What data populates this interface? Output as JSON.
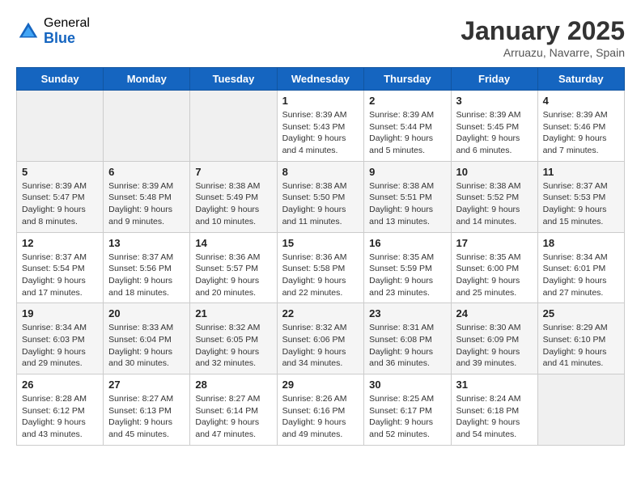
{
  "logo": {
    "general": "General",
    "blue": "Blue"
  },
  "title": "January 2025",
  "subtitle": "Arruazu, Navarre, Spain",
  "weekdays": [
    "Sunday",
    "Monday",
    "Tuesday",
    "Wednesday",
    "Thursday",
    "Friday",
    "Saturday"
  ],
  "weeks": [
    [
      {
        "day": "",
        "empty": true
      },
      {
        "day": "",
        "empty": true
      },
      {
        "day": "",
        "empty": true
      },
      {
        "day": "1",
        "sunrise": "8:39 AM",
        "sunset": "5:43 PM",
        "daylight": "9 hours and 4 minutes."
      },
      {
        "day": "2",
        "sunrise": "8:39 AM",
        "sunset": "5:44 PM",
        "daylight": "9 hours and 5 minutes."
      },
      {
        "day": "3",
        "sunrise": "8:39 AM",
        "sunset": "5:45 PM",
        "daylight": "9 hours and 6 minutes."
      },
      {
        "day": "4",
        "sunrise": "8:39 AM",
        "sunset": "5:46 PM",
        "daylight": "9 hours and 7 minutes."
      }
    ],
    [
      {
        "day": "5",
        "sunrise": "8:39 AM",
        "sunset": "5:47 PM",
        "daylight": "9 hours and 8 minutes."
      },
      {
        "day": "6",
        "sunrise": "8:39 AM",
        "sunset": "5:48 PM",
        "daylight": "9 hours and 9 minutes."
      },
      {
        "day": "7",
        "sunrise": "8:38 AM",
        "sunset": "5:49 PM",
        "daylight": "9 hours and 10 minutes."
      },
      {
        "day": "8",
        "sunrise": "8:38 AM",
        "sunset": "5:50 PM",
        "daylight": "9 hours and 11 minutes."
      },
      {
        "day": "9",
        "sunrise": "8:38 AM",
        "sunset": "5:51 PM",
        "daylight": "9 hours and 13 minutes."
      },
      {
        "day": "10",
        "sunrise": "8:38 AM",
        "sunset": "5:52 PM",
        "daylight": "9 hours and 14 minutes."
      },
      {
        "day": "11",
        "sunrise": "8:37 AM",
        "sunset": "5:53 PM",
        "daylight": "9 hours and 15 minutes."
      }
    ],
    [
      {
        "day": "12",
        "sunrise": "8:37 AM",
        "sunset": "5:54 PM",
        "daylight": "9 hours and 17 minutes."
      },
      {
        "day": "13",
        "sunrise": "8:37 AM",
        "sunset": "5:56 PM",
        "daylight": "9 hours and 18 minutes."
      },
      {
        "day": "14",
        "sunrise": "8:36 AM",
        "sunset": "5:57 PM",
        "daylight": "9 hours and 20 minutes."
      },
      {
        "day": "15",
        "sunrise": "8:36 AM",
        "sunset": "5:58 PM",
        "daylight": "9 hours and 22 minutes."
      },
      {
        "day": "16",
        "sunrise": "8:35 AM",
        "sunset": "5:59 PM",
        "daylight": "9 hours and 23 minutes."
      },
      {
        "day": "17",
        "sunrise": "8:35 AM",
        "sunset": "6:00 PM",
        "daylight": "9 hours and 25 minutes."
      },
      {
        "day": "18",
        "sunrise": "8:34 AM",
        "sunset": "6:01 PM",
        "daylight": "9 hours and 27 minutes."
      }
    ],
    [
      {
        "day": "19",
        "sunrise": "8:34 AM",
        "sunset": "6:03 PM",
        "daylight": "9 hours and 29 minutes."
      },
      {
        "day": "20",
        "sunrise": "8:33 AM",
        "sunset": "6:04 PM",
        "daylight": "9 hours and 30 minutes."
      },
      {
        "day": "21",
        "sunrise": "8:32 AM",
        "sunset": "6:05 PM",
        "daylight": "9 hours and 32 minutes."
      },
      {
        "day": "22",
        "sunrise": "8:32 AM",
        "sunset": "6:06 PM",
        "daylight": "9 hours and 34 minutes."
      },
      {
        "day": "23",
        "sunrise": "8:31 AM",
        "sunset": "6:08 PM",
        "daylight": "9 hours and 36 minutes."
      },
      {
        "day": "24",
        "sunrise": "8:30 AM",
        "sunset": "6:09 PM",
        "daylight": "9 hours and 39 minutes."
      },
      {
        "day": "25",
        "sunrise": "8:29 AM",
        "sunset": "6:10 PM",
        "daylight": "9 hours and 41 minutes."
      }
    ],
    [
      {
        "day": "26",
        "sunrise": "8:28 AM",
        "sunset": "6:12 PM",
        "daylight": "9 hours and 43 minutes."
      },
      {
        "day": "27",
        "sunrise": "8:27 AM",
        "sunset": "6:13 PM",
        "daylight": "9 hours and 45 minutes."
      },
      {
        "day": "28",
        "sunrise": "8:27 AM",
        "sunset": "6:14 PM",
        "daylight": "9 hours and 47 minutes."
      },
      {
        "day": "29",
        "sunrise": "8:26 AM",
        "sunset": "6:16 PM",
        "daylight": "9 hours and 49 minutes."
      },
      {
        "day": "30",
        "sunrise": "8:25 AM",
        "sunset": "6:17 PM",
        "daylight": "9 hours and 52 minutes."
      },
      {
        "day": "31",
        "sunrise": "8:24 AM",
        "sunset": "6:18 PM",
        "daylight": "9 hours and 54 minutes."
      },
      {
        "day": "",
        "empty": true
      }
    ]
  ]
}
